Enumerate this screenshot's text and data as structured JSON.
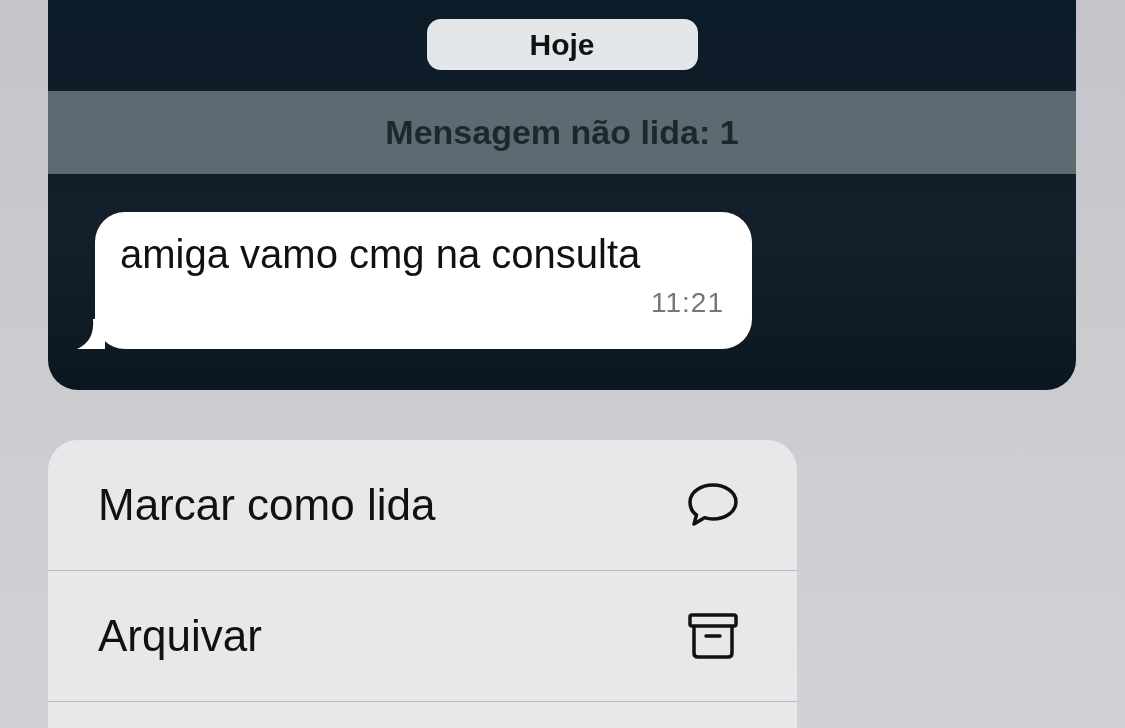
{
  "date_pill": "Hoje",
  "unread_banner": "Mensagem não lida: 1",
  "message": {
    "text": "amiga vamo cmg na consulta",
    "time": "11:21"
  },
  "menu": [
    {
      "label": "Marcar como lida",
      "kind": "mark-read"
    },
    {
      "label": "Arquivar",
      "kind": "archive"
    }
  ]
}
